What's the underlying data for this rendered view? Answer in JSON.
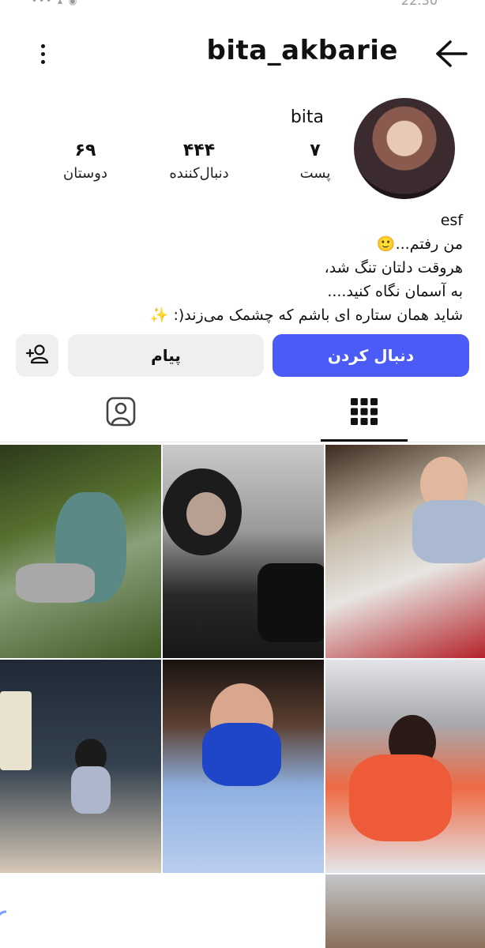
{
  "status_bar": {
    "time": "22:30"
  },
  "header": {
    "username": "bita_akbarie",
    "back_icon": "arrow-right-icon",
    "menu_icon": "vertical-dots-icon"
  },
  "profile": {
    "display_name": "bita",
    "stats": [
      {
        "value": "۷",
        "label": "پست"
      },
      {
        "value": "۴۴۴",
        "label": "دنبال‌کننده"
      },
      {
        "value": "۶۹",
        "label": "دوستان"
      }
    ],
    "bio_lines": [
      "esf",
      "من رفتم...🙂",
      "هروقت دلتان تنگ شد،",
      "به آسمان نگاه کنید....",
      "شاید همان ستاره ای باشم که چشمک می‌زند(: ✨"
    ]
  },
  "actions": {
    "follow_label": "دنبال کردن",
    "message_label": "پیام",
    "add_friend_icon": "person-add-icon"
  },
  "tabs": {
    "grid_icon": "grid-icon",
    "tagged_icon": "tagged-person-icon",
    "active": "grid"
  },
  "colors": {
    "accent": "#4a5cf5",
    "button_bg": "#efefef"
  }
}
